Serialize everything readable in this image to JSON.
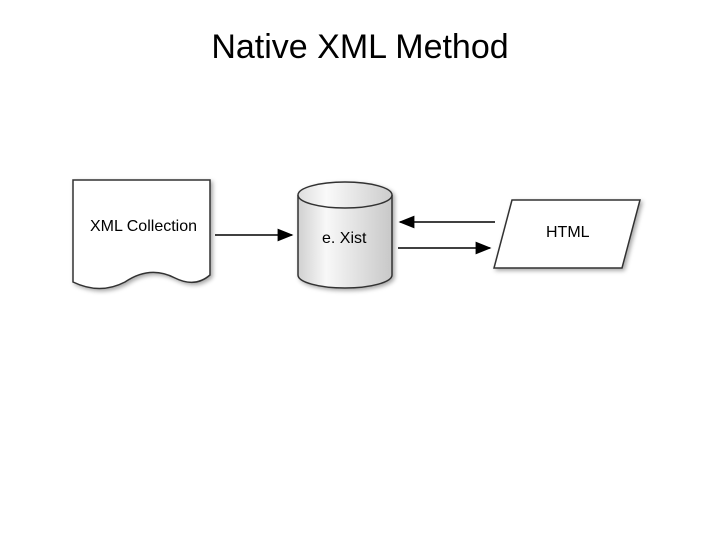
{
  "title": "Native XML Method",
  "nodes": {
    "xml_collection": {
      "label": "XML Collection"
    },
    "exist": {
      "label": "e. Xist"
    },
    "html": {
      "label": "HTML"
    }
  }
}
